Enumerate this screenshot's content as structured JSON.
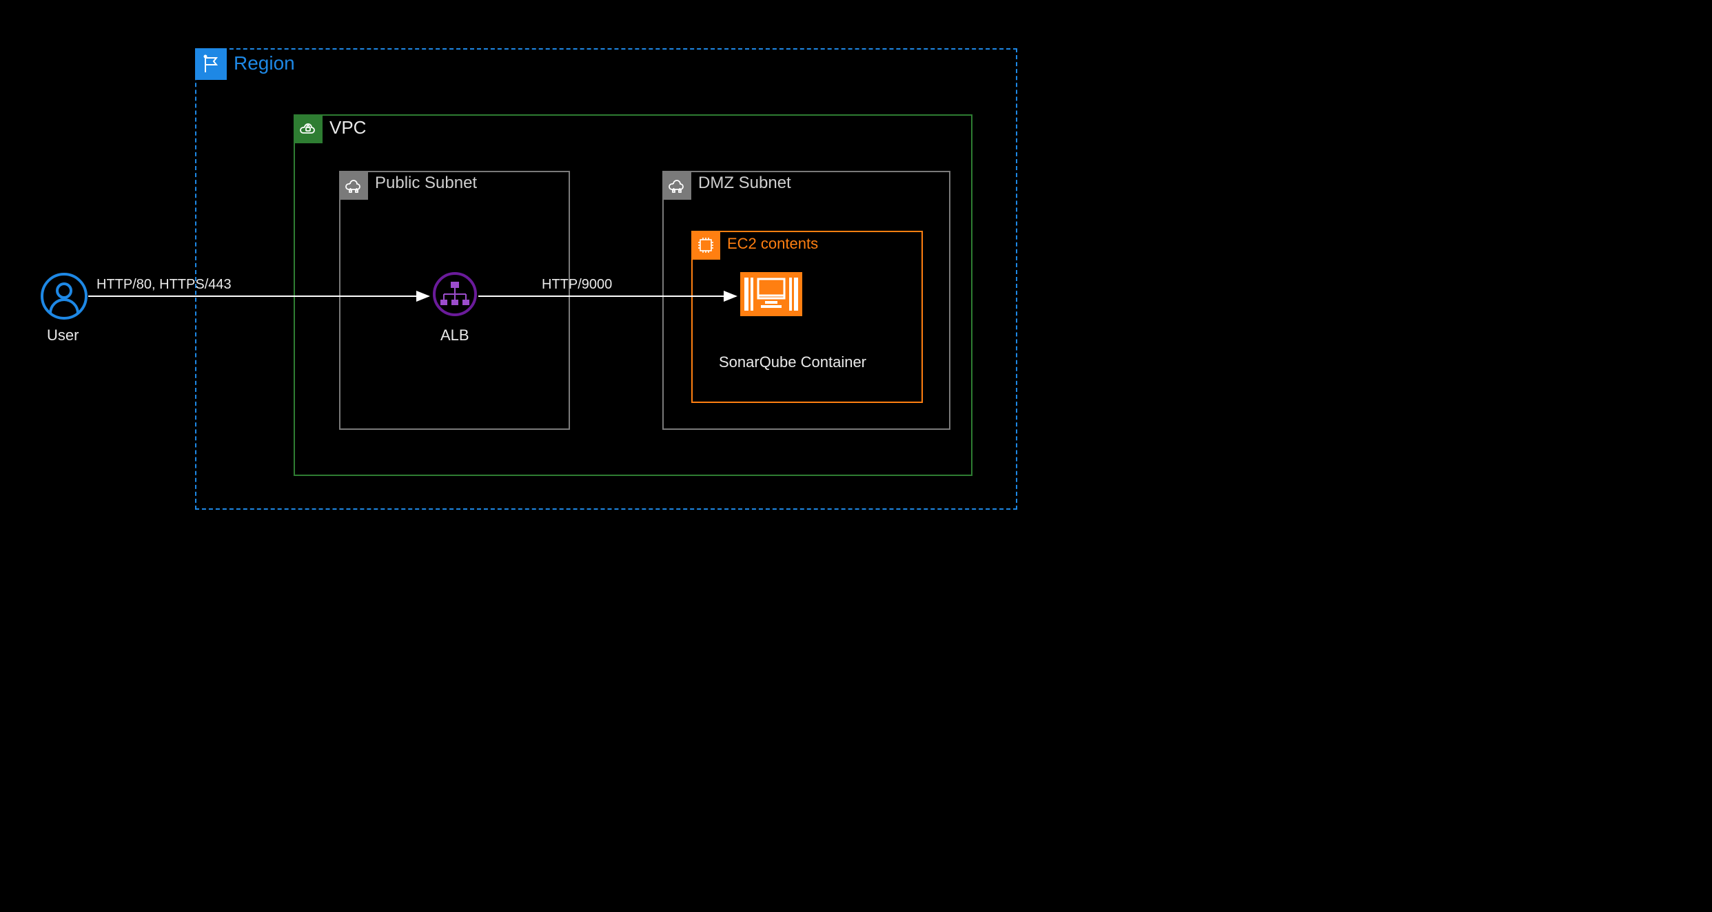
{
  "region": {
    "label": "Region"
  },
  "vpc": {
    "label": "VPC"
  },
  "public_subnet": {
    "label": "Public Subnet"
  },
  "dmz_subnet": {
    "label": "DMZ Subnet"
  },
  "ec2": {
    "label": "EC2 contents"
  },
  "user": {
    "label": "User"
  },
  "alb": {
    "label": "ALB"
  },
  "container": {
    "label": "SonarQube Container"
  },
  "arrow1": {
    "label": "HTTP/80, HTTPS/443"
  },
  "arrow2": {
    "label": "HTTP/9000"
  },
  "colors": {
    "region": "#1e88e5",
    "vpc": "#2e7d32",
    "subnet": "#7a7a7a",
    "ec2": "#ff7f11",
    "alb": "#6a1b9a",
    "container_bg": "#ff7f11"
  }
}
